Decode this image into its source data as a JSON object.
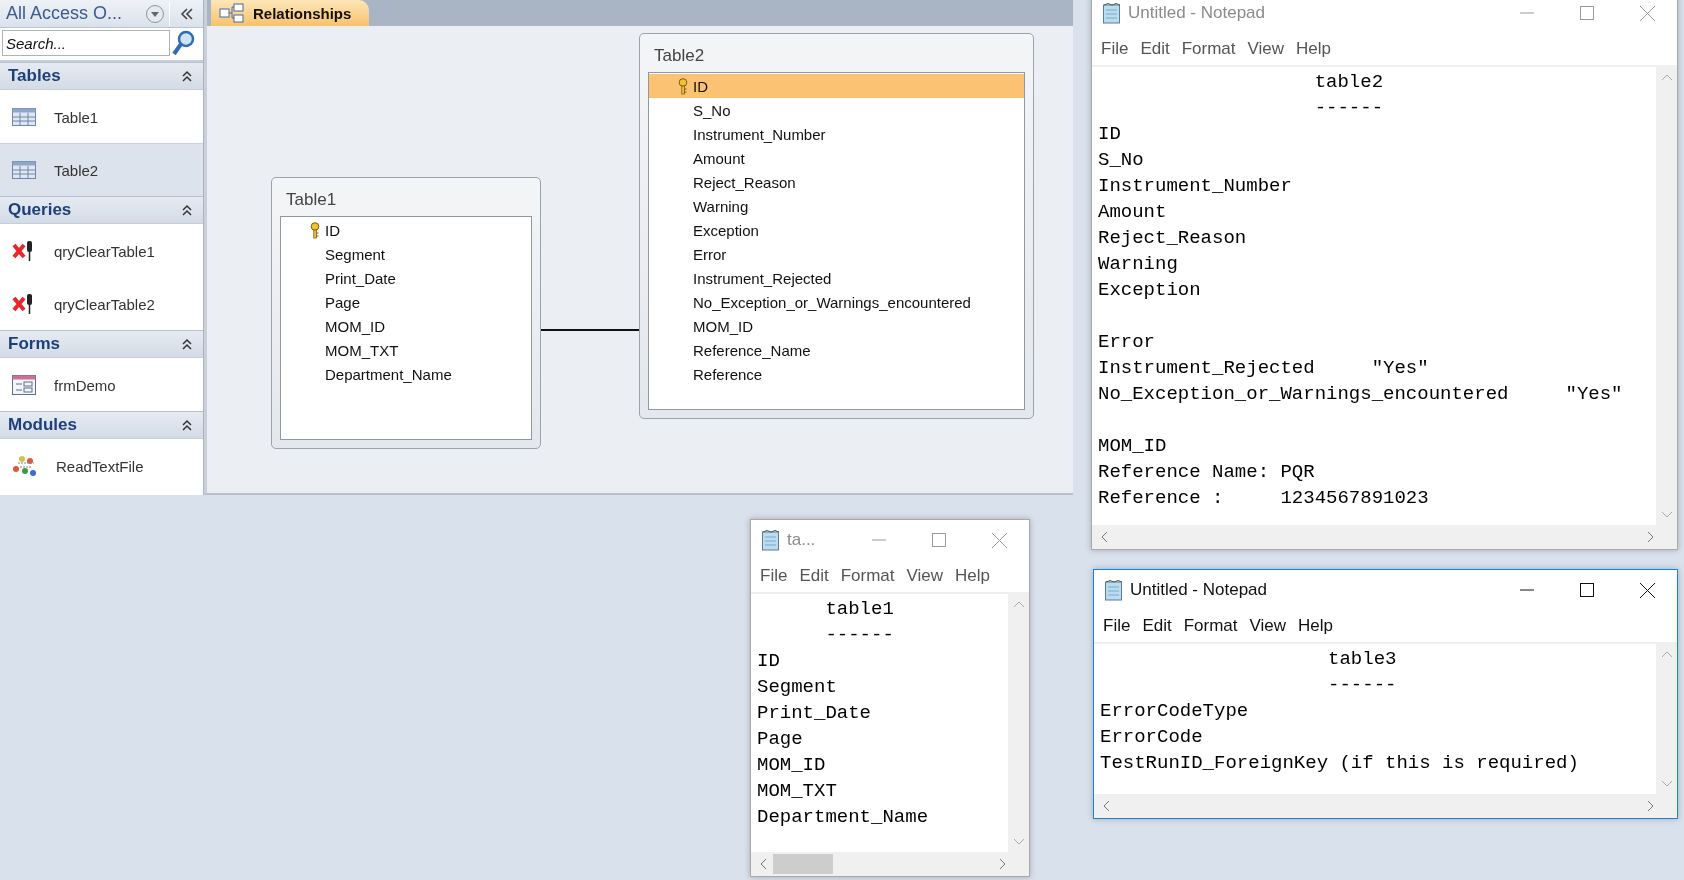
{
  "navigation_pane": {
    "title": "All Access O...",
    "search": {
      "placeholder": "Search..."
    },
    "groups": [
      {
        "kind": "tables",
        "title": "Tables",
        "items": [
          {
            "label": "Table1",
            "selected": false
          },
          {
            "label": "Table2",
            "selected": true
          }
        ]
      },
      {
        "kind": "queries",
        "title": "Queries",
        "items": [
          {
            "label": "qryClearTable1",
            "selected": false
          },
          {
            "label": "qryClearTable2",
            "selected": false
          }
        ]
      },
      {
        "kind": "forms",
        "title": "Forms",
        "items": [
          {
            "label": "frmDemo",
            "selected": false
          }
        ]
      },
      {
        "kind": "modules",
        "title": "Modules",
        "items": [
          {
            "label": "ReadTextFile",
            "selected": false
          }
        ]
      }
    ]
  },
  "document_tab": {
    "label": "Relationships",
    "selected": true
  },
  "relationship_tables": [
    {
      "title": "Table1",
      "fields": [
        {
          "name": "ID",
          "primary_key": true,
          "selected": false
        },
        {
          "name": "Segment",
          "primary_key": false,
          "selected": false
        },
        {
          "name": "Print_Date",
          "primary_key": false,
          "selected": false
        },
        {
          "name": "Page",
          "primary_key": false,
          "selected": false
        },
        {
          "name": "MOM_ID",
          "primary_key": false,
          "selected": false
        },
        {
          "name": "MOM_TXT",
          "primary_key": false,
          "selected": false
        },
        {
          "name": "Department_Name",
          "primary_key": false,
          "selected": false
        }
      ]
    },
    {
      "title": "Table2",
      "fields": [
        {
          "name": "ID",
          "primary_key": true,
          "selected": true
        },
        {
          "name": "S_No",
          "primary_key": false,
          "selected": false
        },
        {
          "name": "Instrument_Number",
          "primary_key": false,
          "selected": false
        },
        {
          "name": "Amount",
          "primary_key": false,
          "selected": false
        },
        {
          "name": "Reject_Reason",
          "primary_key": false,
          "selected": false
        },
        {
          "name": "Warning",
          "primary_key": false,
          "selected": false
        },
        {
          "name": "Exception",
          "primary_key": false,
          "selected": false
        },
        {
          "name": "Error",
          "primary_key": false,
          "selected": false
        },
        {
          "name": "Instrument_Rejected",
          "primary_key": false,
          "selected": false
        },
        {
          "name": "No_Exception_or_Warnings_encountered",
          "primary_key": false,
          "selected": false
        },
        {
          "name": "MOM_ID",
          "primary_key": false,
          "selected": false
        },
        {
          "name": "Reference_Name",
          "primary_key": false,
          "selected": false
        },
        {
          "name": "Reference",
          "primary_key": false,
          "selected": false
        }
      ]
    }
  ],
  "notepad_windows": [
    {
      "title": "Untitled - Notepad",
      "active": false,
      "menu": [
        "File",
        "Edit",
        "Format",
        "View",
        "Help"
      ],
      "text": "                   table2\n                   ------\nID\nS_No\nInstrument_Number\nAmount\nReject_Reason\nWarning\nException\n\nError\nInstrument_Rejected     \"Yes\"\nNo_Exception_or_Warnings_encountered     \"Yes\"\n\nMOM_ID\nReference Name: PQR\nReference :     1234567891023"
    },
    {
      "title": "ta...",
      "active": false,
      "menu": [
        "File",
        "Edit",
        "Format",
        "View",
        "Help"
      ],
      "text": "      table1\n      ------\nID\nSegment\nPrint_Date\nPage\nMOM_ID\nMOM_TXT\nDepartment_Name"
    },
    {
      "title": "Untitled - Notepad",
      "active": true,
      "menu": [
        "File",
        "Edit",
        "Format",
        "View",
        "Help"
      ],
      "text": "                    table3\n                    ------\nErrorCodeType\nErrorCode\nTestRunID_ForeignKey (if this is required)"
    }
  ]
}
